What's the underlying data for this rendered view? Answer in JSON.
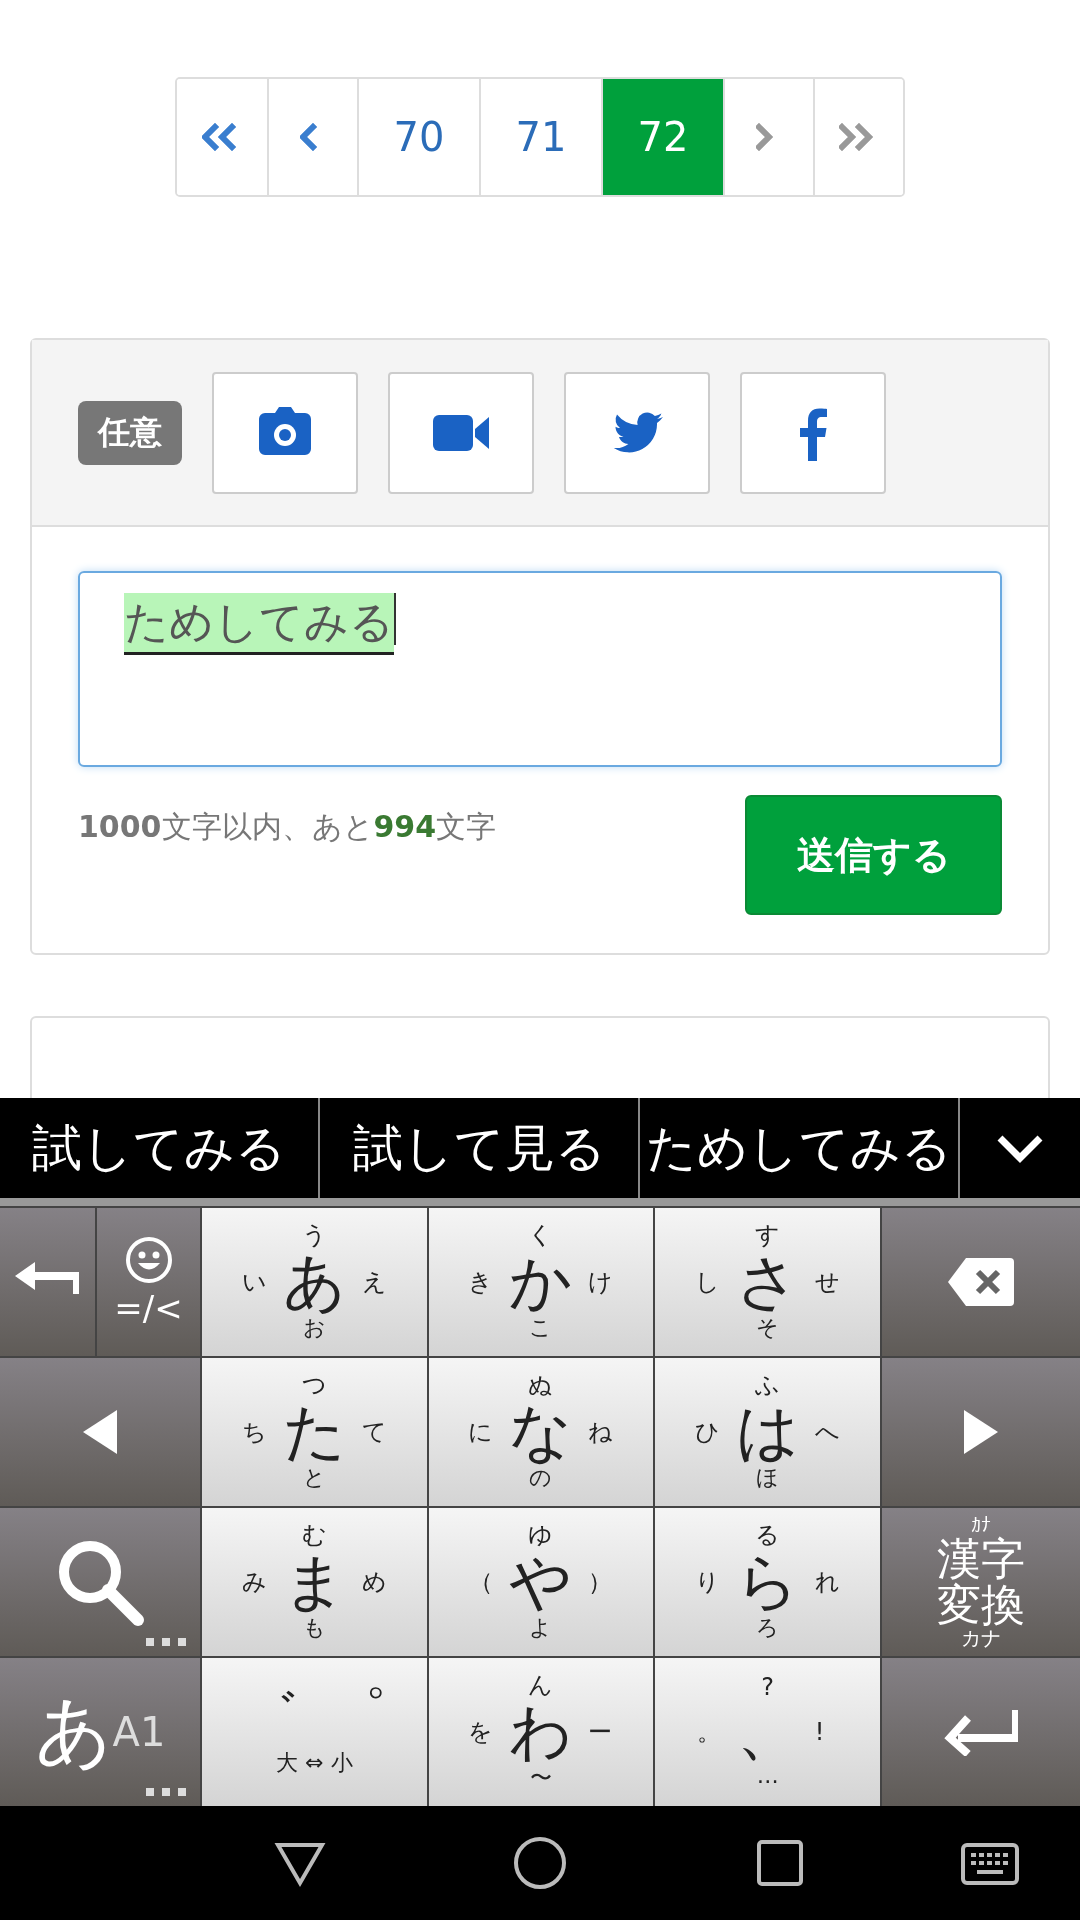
{
  "pagination": [
    {
      "kind": "first",
      "selected": false,
      "disabled": false
    },
    {
      "kind": "prev",
      "selected": false,
      "disabled": false
    },
    {
      "kind": "page",
      "label": "70",
      "selected": false,
      "disabled": false
    },
    {
      "kind": "page",
      "label": "71",
      "selected": false,
      "disabled": false
    },
    {
      "kind": "page",
      "label": "72",
      "selected": true,
      "disabled": false
    },
    {
      "kind": "next",
      "selected": false,
      "disabled": true
    },
    {
      "kind": "last",
      "selected": false,
      "disabled": true
    }
  ],
  "post_form": {
    "badge": "任意",
    "attachments": [
      {
        "kind": "camera"
      },
      {
        "kind": "video"
      },
      {
        "kind": "twitter"
      },
      {
        "kind": "facebook"
      }
    ],
    "message": {
      "value": "ためしてみる",
      "composing": true
    },
    "counter": "**1000**文字以内、あと**994**文字",
    "submit": "送信する"
  },
  "keyboard": {
    "candidates": [
      "試してみる",
      "試して見る",
      "ためしてみる"
    ],
    "rows": [
      [
        {
          "kind": "pair",
          "keys": [
            {
              "kind": "undo"
            },
            {
              "kind": "emoji",
              "label": "=/<"
            }
          ]
        },
        {
          "kind": "kana",
          "main": "あ",
          "up": "う",
          "left": "い",
          "right": "え",
          "down": "お"
        },
        {
          "kind": "kana",
          "main": "か",
          "up": "く",
          "left": "き",
          "right": "け",
          "down": "こ"
        },
        {
          "kind": "kana",
          "main": "さ",
          "up": "す",
          "left": "し",
          "right": "せ",
          "down": "そ"
        },
        {
          "kind": "backspace"
        }
      ],
      [
        {
          "kind": "left"
        },
        {
          "kind": "kana",
          "main": "た",
          "up": "つ",
          "left": "ち",
          "right": "て",
          "down": "と"
        },
        {
          "kind": "kana",
          "main": "な",
          "up": "ぬ",
          "left": "に",
          "right": "ね",
          "down": "の"
        },
        {
          "kind": "kana",
          "main": "は",
          "up": "ふ",
          "left": "ひ",
          "right": "へ",
          "down": "ほ"
        },
        {
          "kind": "right"
        }
      ],
      [
        {
          "kind": "search"
        },
        {
          "kind": "kana",
          "main": "ま",
          "up": "む",
          "left": "み",
          "right": "め",
          "down": "も"
        },
        {
          "kind": "kana",
          "main": "や",
          "up": "ゆ",
          "left": "（",
          "right": "）",
          "down": "よ"
        },
        {
          "kind": "kana",
          "main": "ら",
          "up": "る",
          "left": "り",
          "right": "れ",
          "down": "ろ"
        },
        {
          "kind": "convert",
          "up": "ｶﾅ",
          "label": "漢字変換",
          "down": "カナ"
        }
      ],
      [
        {
          "kind": "mode",
          "label": "あ",
          "sub": "A1"
        },
        {
          "kind": "dakuten",
          "marks": [
            "゛",
            "゜"
          ],
          "label": "大 ⇔ 小"
        },
        {
          "kind": "kana",
          "main": "わ",
          "up": "ん",
          "left": "を",
          "right": "ー",
          "down": "〜"
        },
        {
          "kind": "kana",
          "main": "、",
          "up": "?",
          "left": "。",
          "right": "!",
          "down": "…"
        },
        {
          "kind": "enter"
        }
      ]
    ]
  }
}
